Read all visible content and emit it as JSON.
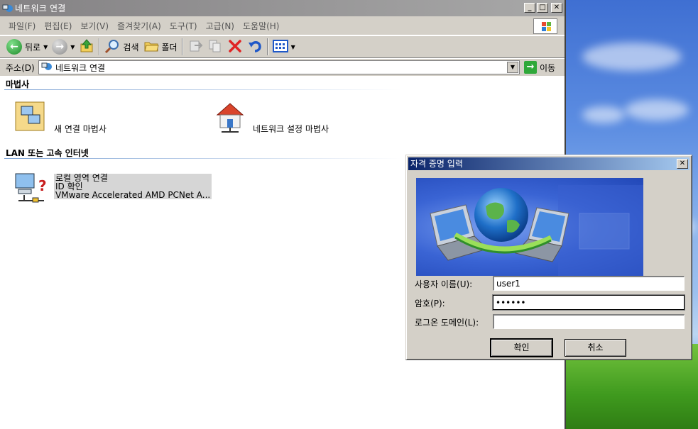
{
  "explorer": {
    "title": "네트워크 연결",
    "menu": [
      "파일(F)",
      "편집(E)",
      "보기(V)",
      "즐겨찾기(A)",
      "도구(T)",
      "고급(N)",
      "도움말(H)"
    ],
    "toolbar": {
      "back_label": "뒤로",
      "search_label": "검색",
      "folders_label": "폴더"
    },
    "address": {
      "label": "주소(D)",
      "value": "네트워크 연결",
      "go_label": "이동"
    },
    "groups": [
      {
        "header": "마법사",
        "items": [
          {
            "label": "새 연결 마법사",
            "icon": "new-connection-wizard-icon"
          },
          {
            "label": "네트워크 설정 마법사",
            "icon": "network-setup-wizard-icon"
          }
        ]
      },
      {
        "header": "LAN 또는 고속 인터넷",
        "items": [
          {
            "name": "로컬 영역 연결",
            "status": "ID 확인",
            "device": "VMware Accelerated AMD PCNet A...",
            "icon": "lan-connection-icon"
          }
        ]
      }
    ]
  },
  "dialog": {
    "title": "자격 증명 입력",
    "username_label": "사용자 이름(U):",
    "username_value": "user1",
    "password_label": "암호(P):",
    "password_value": "••••••",
    "domain_label": "로그온 도메인(L):",
    "domain_value": "",
    "ok_label": "확인",
    "cancel_label": "취소"
  }
}
